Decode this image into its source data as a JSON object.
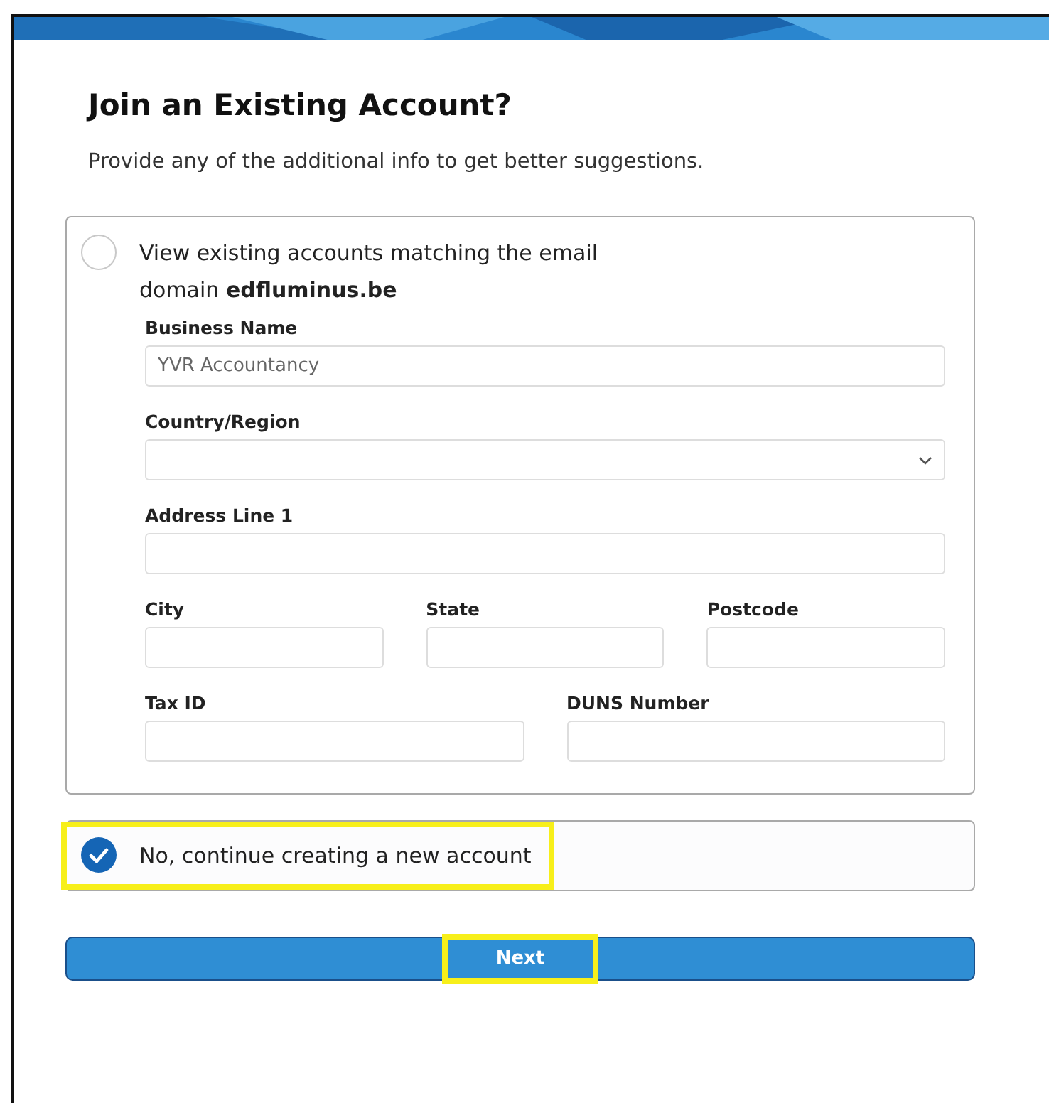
{
  "title": "Join an Existing Account?",
  "subtitle": "Provide any of the additional info to get better suggestions.",
  "options": [
    {
      "kind": "fields",
      "label": "View existing accounts matching the email domain **edfluminus.be**",
      "selected": false,
      "highlighted": false,
      "field_rows": [
        [
          {
            "kind": "text",
            "label": "Business Name",
            "placeholder": "YVR Accountancy"
          }
        ],
        [
          {
            "kind": "select",
            "label": "Country/Region"
          }
        ],
        [
          {
            "kind": "text",
            "label": "Address Line 1"
          }
        ],
        [
          {
            "kind": "text",
            "label": "City"
          },
          {
            "kind": "text",
            "label": "State"
          },
          {
            "kind": "text",
            "label": "Postcode"
          }
        ],
        [
          {
            "kind": "text",
            "label": "Tax ID"
          },
          {
            "kind": "text",
            "label": "DUNS Number"
          }
        ]
      ]
    },
    {
      "kind": "plain",
      "label": "No, continue creating a new account",
      "selected": true,
      "highlighted": true
    }
  ],
  "next_button": {
    "label": "Next",
    "highlighted": true
  }
}
